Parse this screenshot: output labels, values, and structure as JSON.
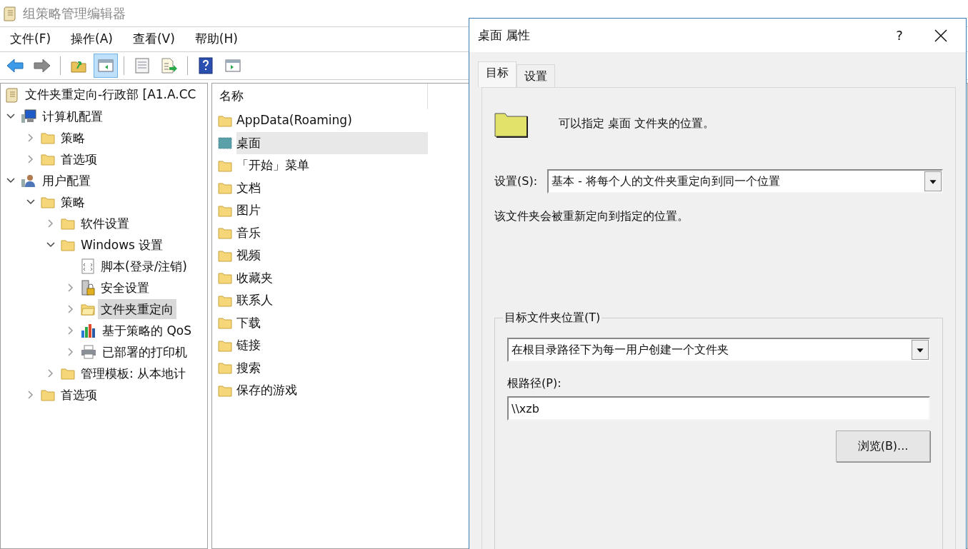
{
  "window": {
    "title": "组策略管理编辑器"
  },
  "menu": [
    {
      "label": "文件(F)"
    },
    {
      "label": "操作(A)"
    },
    {
      "label": "查看(V)"
    },
    {
      "label": "帮助(H)"
    }
  ],
  "toolbar": [
    [
      {
        "kind": "back",
        "pressed": false
      },
      {
        "kind": "forward",
        "pressed": false
      }
    ],
    [
      {
        "kind": "up",
        "pressed": false
      },
      {
        "kind": "tree",
        "pressed": true
      }
    ],
    [
      {
        "kind": "properties",
        "pressed": false
      },
      {
        "kind": "export",
        "pressed": false
      }
    ],
    [
      {
        "kind": "help",
        "pressed": false
      },
      {
        "kind": "action",
        "pressed": false
      }
    ]
  ],
  "tree": {
    "root": {
      "label": "文件夹重定向-行政部 [A1.A.CC",
      "kind": "scroll"
    },
    "items": [
      {
        "label": "计算机配置",
        "kind": "computer",
        "expandable": true,
        "expanded": true,
        "selected": false,
        "children": [
          {
            "label": "策略",
            "kind": "folder",
            "expandable": true,
            "expanded": false,
            "selected": false
          },
          {
            "label": "首选项",
            "kind": "folder",
            "expandable": true,
            "expanded": false,
            "selected": false
          }
        ]
      },
      {
        "label": "用户配置",
        "kind": "user",
        "expandable": true,
        "expanded": true,
        "selected": false,
        "children": [
          {
            "label": "策略",
            "kind": "folder",
            "expandable": true,
            "expanded": true,
            "selected": false,
            "children": [
              {
                "label": "软件设置",
                "kind": "folder",
                "expandable": true,
                "expanded": false,
                "selected": false
              },
              {
                "label": "Windows 设置",
                "kind": "folder",
                "expandable": true,
                "expanded": true,
                "selected": false,
                "children": [
                  {
                    "label": "脚本(登录/注销)",
                    "kind": "script",
                    "expandable": false,
                    "selected": false
                  },
                  {
                    "label": "安全设置",
                    "kind": "security",
                    "expandable": true,
                    "expanded": false,
                    "selected": false
                  },
                  {
                    "label": "文件夹重定向",
                    "kind": "folder-open",
                    "expandable": true,
                    "expanded": false,
                    "selected": true
                  },
                  {
                    "label": "基于策略的 QoS",
                    "kind": "chart",
                    "expandable": true,
                    "expanded": false,
                    "selected": false
                  },
                  {
                    "label": "已部署的打印机",
                    "kind": "printer",
                    "expandable": true,
                    "expanded": false,
                    "selected": false
                  }
                ]
              },
              {
                "label": "管理模板: 从本地计",
                "kind": "folder",
                "expandable": true,
                "expanded": false,
                "selected": false
              }
            ]
          },
          {
            "label": "首选项",
            "kind": "folder",
            "expandable": true,
            "expanded": false,
            "selected": false
          }
        ]
      }
    ]
  },
  "list": {
    "column": "名称",
    "items": [
      {
        "label": "AppData(Roaming)",
        "kind": "folder",
        "selected": false
      },
      {
        "label": "桌面",
        "kind": "desktop",
        "selected": true
      },
      {
        "label": "「开始」菜单",
        "kind": "folder",
        "selected": false
      },
      {
        "label": "文档",
        "kind": "folder",
        "selected": false
      },
      {
        "label": "图片",
        "kind": "folder",
        "selected": false
      },
      {
        "label": "音乐",
        "kind": "folder",
        "selected": false
      },
      {
        "label": "视频",
        "kind": "folder",
        "selected": false
      },
      {
        "label": "收藏夹",
        "kind": "folder",
        "selected": false
      },
      {
        "label": "联系人",
        "kind": "folder",
        "selected": false
      },
      {
        "label": "下载",
        "kind": "folder",
        "selected": false
      },
      {
        "label": "链接",
        "kind": "folder",
        "selected": false
      },
      {
        "label": "搜索",
        "kind": "folder",
        "selected": false
      },
      {
        "label": "保存的游戏",
        "kind": "folder",
        "selected": false
      }
    ]
  },
  "dialog": {
    "title": "桌面 属性",
    "help": "?",
    "tabs": [
      {
        "label": "目标",
        "selected": true
      },
      {
        "label": "设置",
        "selected": false
      }
    ],
    "description": "可以指定 桌面 文件夹的位置。",
    "setting_label": "设置(S):",
    "setting_value": "基本 - 将每个人的文件夹重定向到同一个位置",
    "note": "该文件夹会被重新定向到指定的位置。",
    "group": {
      "title": "目标文件夹位置(T)",
      "option": "在根目录路径下为每一用户创建一个文件夹",
      "path_label": "根路径(P):",
      "path_value": "\\\\xzb",
      "browse": "浏览(B)..."
    }
  }
}
